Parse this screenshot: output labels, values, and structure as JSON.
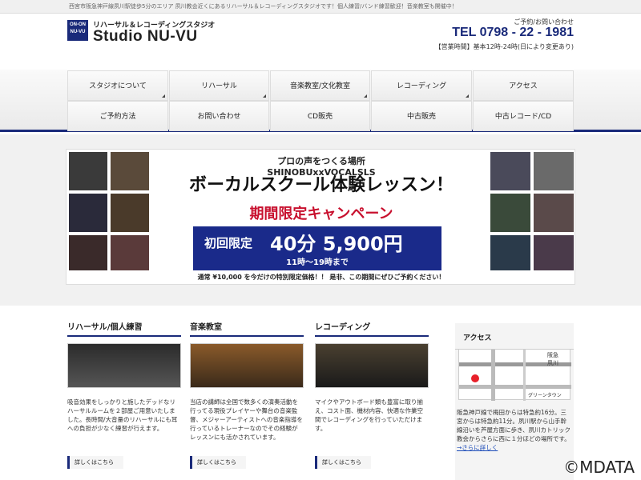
{
  "topbar": {
    "text": "西宮市阪急神戸線夙川駅徒歩5分のエリア 夙川教会近くにあるリハーサル＆レコーディングスタジオです！個人練習/バンド練習歓迎！音楽教室も開催中！"
  },
  "header": {
    "logo_mark": "ON-ON NU-VU",
    "logo_sub": "リハーサル＆レコーディングスタジオ",
    "logo_main": "Studio NU-VU",
    "contact_label": "ご予約/お問い合わせ",
    "tel": "TEL 0798 - 22 - 1981",
    "hours": "【営業時間】基本12時-24時(日により変更あり)"
  },
  "nav": {
    "row1": [
      "スタジオについて",
      "リハーサル",
      "音楽教室/文化教室",
      "レコーディング",
      "アクセス"
    ],
    "row2": [
      "ご予約方法",
      "お問い合わせ",
      "CD販売",
      "中古販売",
      "中古レコード/CD"
    ]
  },
  "banner": {
    "headline": "プロの声をつくる場所 SHINOBUxxVOCALSLS",
    "title": "ボーカルスクール体験レッスン！",
    "campaign": "期間限定キャンペーン",
    "price_label": "初回限定",
    "price": "40分 5,900円",
    "time": "11時〜19時まで",
    "footer": "通常 ¥10,000 を今だけの特別限定価格！！ 是非、この期間にぜひご予約ください！"
  },
  "columns": [
    {
      "title": "リハーサル/個人練習",
      "text": "吸音効果をしっかりと施したデッドなリハーサルルームを２部屋ご用意いたしました。長時間/大音量のリハーサルにも耳への負担が少なく練習が行えます。",
      "more": "詳しくはこちら"
    },
    {
      "title": "音楽教室",
      "text": "当店の講師は全国で数多くの演奏活動を行ってる現役プレイヤーや舞台の音楽監督、メジャーアーティストへの音楽指導を行っているトレーナーなのでその経験がレッスンにも活かされています。",
      "more": "詳しくはこちら"
    },
    {
      "title": "レコーディング",
      "text": "マイクやアウトボード類も豊富に取り揃え、コスト面、機材内容、快適な作業空間でレコーディングを行っていただけます。",
      "more": "詳しくはこちら"
    }
  ],
  "access": {
    "title": "アクセス",
    "map_labels": [
      "阪急",
      "夙川",
      "グリーンタウン"
    ],
    "text": "阪急神戸線で梅田からは特急約16分。三宮からは特急約11分。夙川駅から山手幹線沿いを芦屋方面に歩き、夙川カトリック教会からさらに西に１分ほどの場所です。",
    "more": "→さらに詳しく"
  },
  "watermark": "©MDATA",
  "colors": {
    "brand": "#1a2a7a",
    "accent_red": "#c8102e",
    "link": "#1a4ab8"
  }
}
